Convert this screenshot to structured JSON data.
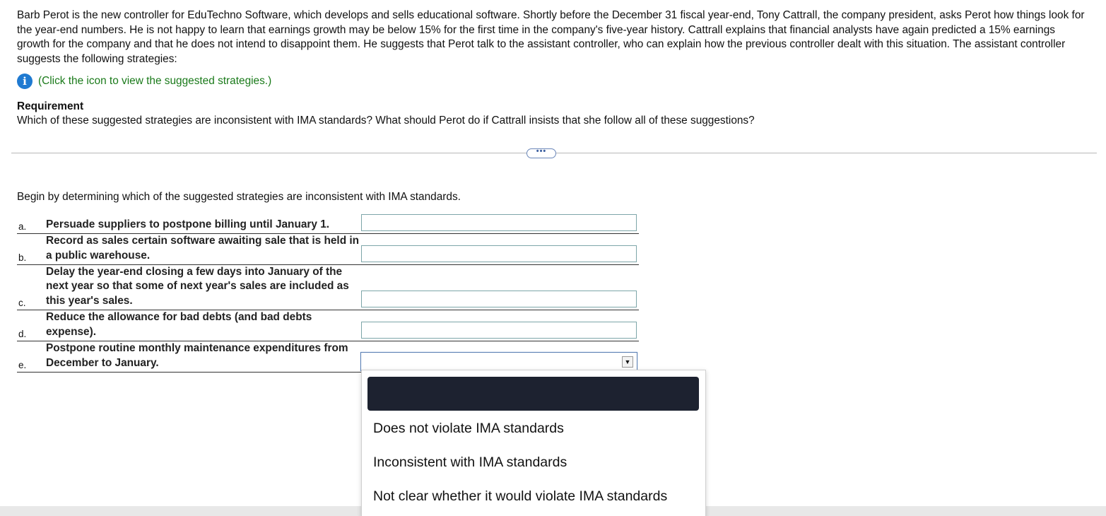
{
  "intro": {
    "paragraph": "Barb Perot is the new controller for EduTechno Software, which develops and sells educational software. Shortly before the December 31 fiscal year-end, Tony Cattrall, the company president, asks Perot how things look for the year-end numbers. He is not happy to learn that earnings growth may be below 15% for the first time in the company's five-year history. Cattrall explains that financial analysts have again predicted a 15% earnings growth for the company and that he does not intend to disappoint them. He suggests that Perot talk to the assistant controller, who can explain how the previous controller dealt with this situation. The assistant controller suggests the following strategies:",
    "info_icon": "info-icon",
    "info_icon_glyph": "i",
    "info_link": "(Click the icon to view the suggested strategies.)"
  },
  "requirement": {
    "title": "Requirement",
    "text": "Which of these suggested strategies are inconsistent with IMA standards? What should Perot do if Cattrall insists that she follow all of these suggestions?"
  },
  "more_button": {
    "label": "•••"
  },
  "question": {
    "prompt": "Begin by determining which of the suggested strategies are inconsistent with IMA standards.",
    "items": [
      {
        "letter": "a.",
        "text": "Persuade suppliers to postpone billing until January 1.",
        "answer": ""
      },
      {
        "letter": "b.",
        "text": "Record as sales certain software awaiting sale that is held in a public warehouse.",
        "answer": ""
      },
      {
        "letter": "c.",
        "text": "Delay the year-end closing a few days into January of the next year so that some of next year's sales are included as this year's sales.",
        "answer": ""
      },
      {
        "letter": "d.",
        "text": "Reduce the allowance for bad debts (and bad debts expense).",
        "answer": ""
      },
      {
        "letter": "e.",
        "text": "Postpone routine monthly maintenance expenditures from December to January.",
        "answer": ""
      }
    ]
  },
  "dropdown": {
    "arrow": "▼",
    "options": [
      "",
      "Does not violate IMA standards",
      "Inconsistent with IMA standards",
      "Not clear whether it would violate IMA standards"
    ]
  },
  "colors": {
    "link": "#1a7a1a",
    "info_icon": "#1f7ad1",
    "highlight_option": "#1d2230"
  }
}
